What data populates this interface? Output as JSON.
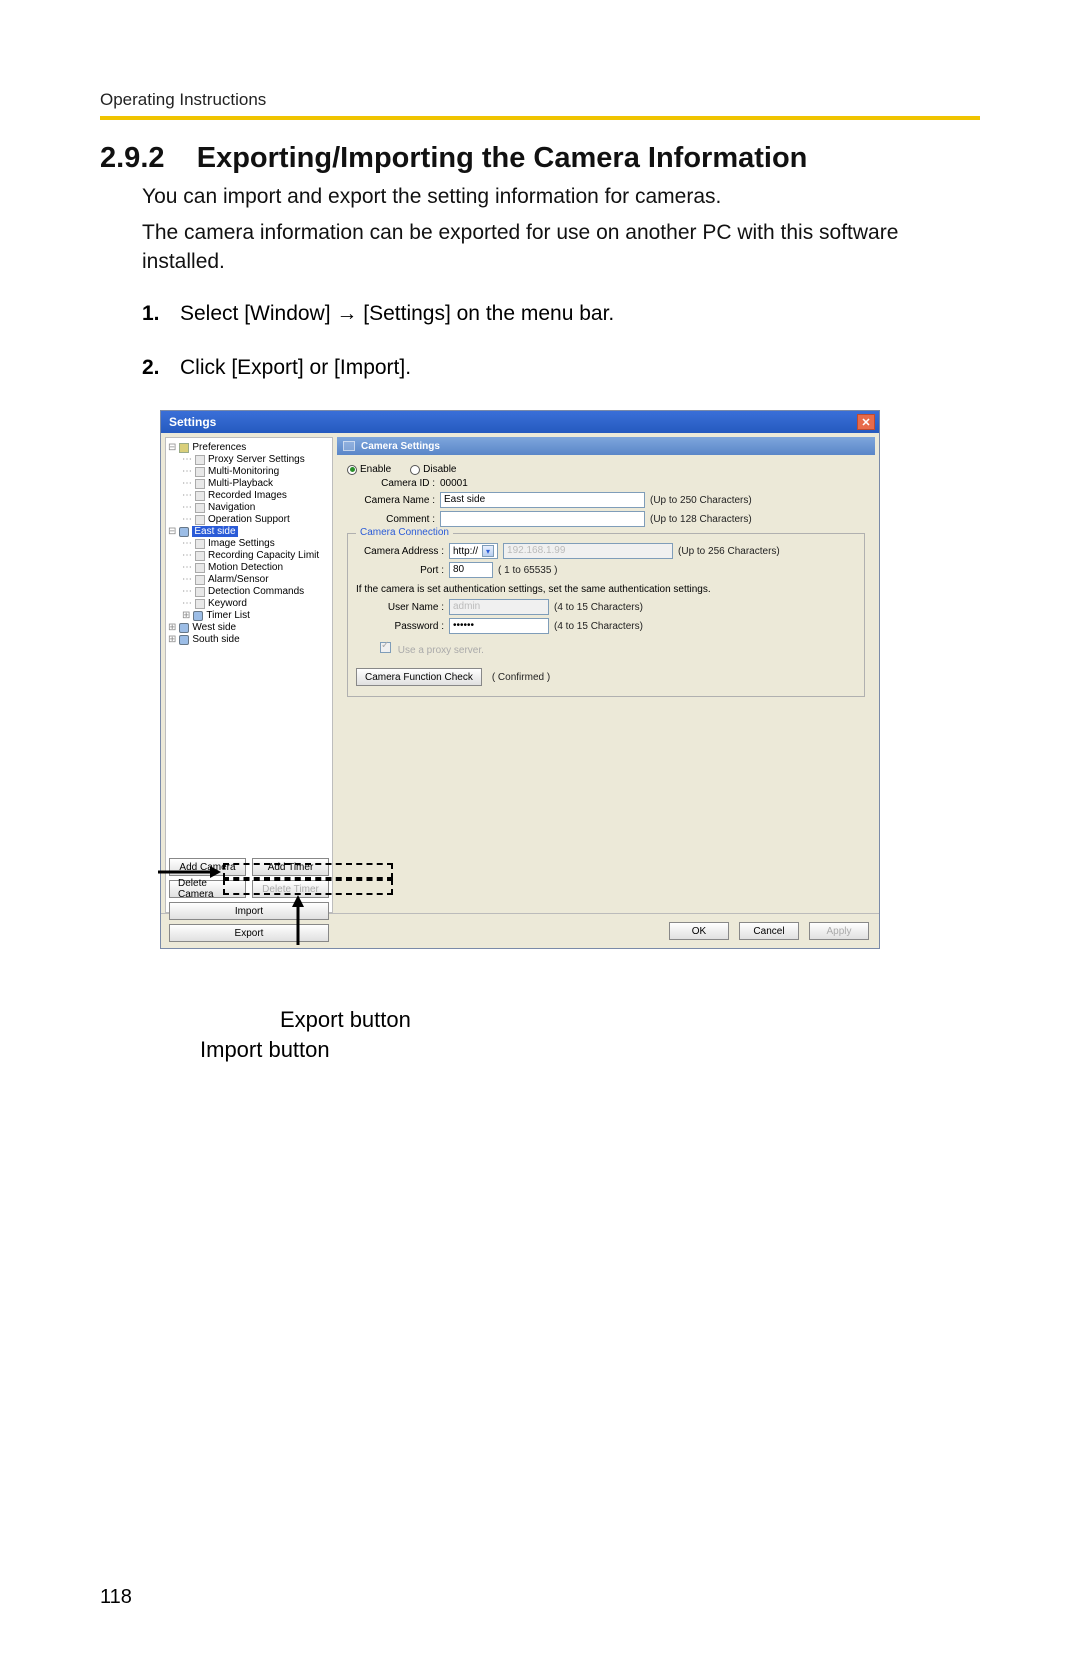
{
  "header": {
    "label": "Operating Instructions"
  },
  "section": {
    "number": "2.9.2",
    "title": "Exporting/Importing the Camera Information"
  },
  "paragraphs": {
    "p1": "You can import and export the setting information for cameras.",
    "p2": "The camera information can be exported for use on another PC with this software installed."
  },
  "steps": {
    "s1_num": "1.",
    "s1_a": "Select [Window]",
    "s1_arrow": "→",
    "s1_b": "[Settings] on the menu bar.",
    "s2_num": "2.",
    "s2": "Click [Export] or [Import]."
  },
  "dialog": {
    "title": "Settings",
    "panel_title": "Camera Settings",
    "tree": {
      "preferences": "Preferences",
      "proxy": "Proxy Server Settings",
      "multi_mon": "Multi-Monitoring",
      "multi_play": "Multi-Playback",
      "rec_img": "Recorded Images",
      "nav": "Navigation",
      "op_support": "Operation Support",
      "east": "East side",
      "image_settings": "Image Settings",
      "rec_cap": "Recording Capacity Limit",
      "motion": "Motion Detection",
      "alarm": "Alarm/Sensor",
      "det_cmd": "Detection Commands",
      "keyword": "Keyword",
      "timer_list": "Timer List",
      "west": "West side",
      "south": "South side"
    },
    "radio": {
      "enable": "Enable",
      "disable": "Disable"
    },
    "camera_id_label": "Camera ID :",
    "camera_id_value": "00001",
    "camera_name_label": "Camera Name :",
    "camera_name_value": "East side",
    "camera_name_hint": "(Up to 250 Characters)",
    "comment_label": "Comment :",
    "comment_value": "",
    "comment_hint": "(Up to 128 Characters)",
    "group_title": "Camera Connection",
    "addr_label": "Camera Address :",
    "addr_scheme": "http://",
    "addr_value": "192.168.1.99",
    "addr_hint": "(Up to 256 Characters)",
    "port_label": "Port :",
    "port_value": "80",
    "port_hint": "( 1 to 65535 )",
    "auth_note": "If the camera is set authentication settings, set the same authentication settings.",
    "user_label": "User Name :",
    "user_value": "admin",
    "user_hint": "(4 to 15 Characters)",
    "pass_label": "Password :",
    "pass_value": "••••••",
    "pass_hint": "(4 to 15 Characters)",
    "proxy_label": "Use a proxy server.",
    "func_check_btn": "Camera Function Check",
    "func_check_status": "( Confirmed )",
    "side_buttons": {
      "add_camera": "Add Camera",
      "add_timer": "Add Timer",
      "delete_camera": "Delete Camera",
      "delete_timer": "Delete Timer",
      "import": "Import",
      "export": "Export"
    },
    "footer": {
      "ok": "OK",
      "cancel": "Cancel",
      "apply": "Apply"
    }
  },
  "callouts": {
    "export_label": "Export button",
    "import_label": "Import button"
  },
  "page_number": "118"
}
